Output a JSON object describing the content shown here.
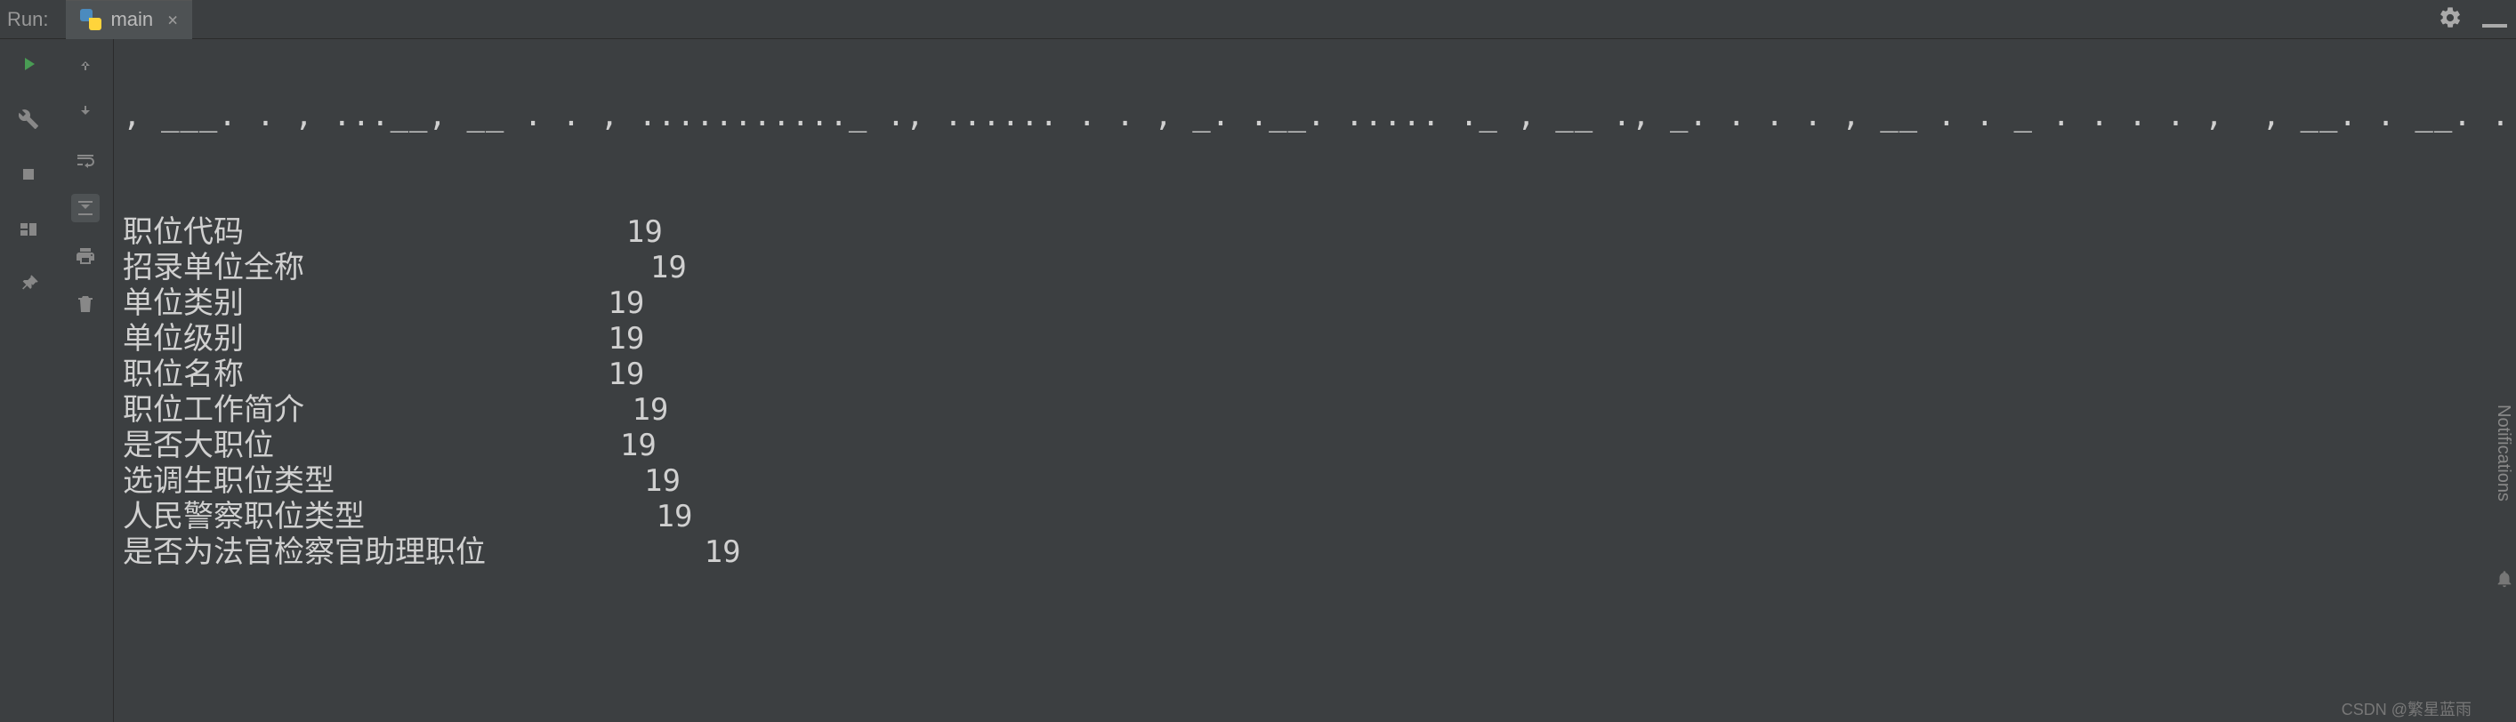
{
  "header": {
    "label": "Run:",
    "tab_name": "main",
    "tab_close": "×"
  },
  "output": {
    "truncated_top": ", _ _ _ . . , ___, _ . . , _ . . _ _ _ . . _ _ ., _ . . . . , _ _ . . _ . . . . . . , _ _ , , . . . , , _ . . ,  , . . . . . ,  , , . . _ _ .  . _ . , _ . ., . . . . . . . . . , _ .,  _ . . _ _ . . . . . . . . . . _ _ . ,  . . . . . . . . . . . .  ,",
    "rows": [
      {
        "label": "职位代码",
        "value": "19",
        "pad": "                     "
      },
      {
        "label": "招录单位全称",
        "value": "19",
        "pad": "                   "
      },
      {
        "label": "单位类别",
        "value": "19",
        "pad": "                    "
      },
      {
        "label": "单位级别",
        "value": "19",
        "pad": "                    "
      },
      {
        "label": "职位名称",
        "value": "19",
        "pad": "                    "
      },
      {
        "label": "职位工作简介",
        "value": "19",
        "pad": "                  "
      },
      {
        "label": "是否大职位",
        "value": "19",
        "pad": "                   "
      },
      {
        "label": "选调生职位类型",
        "value": "19",
        "pad": "                 "
      },
      {
        "label": "人民警察职位类型",
        "value": "19",
        "pad": "                "
      },
      {
        "label": "是否为法官检察官助理职位",
        "value": "19",
        "pad": "            "
      }
    ]
  },
  "side": {
    "label": "Notifications"
  },
  "watermark": "CSDN @繁星蓝雨"
}
